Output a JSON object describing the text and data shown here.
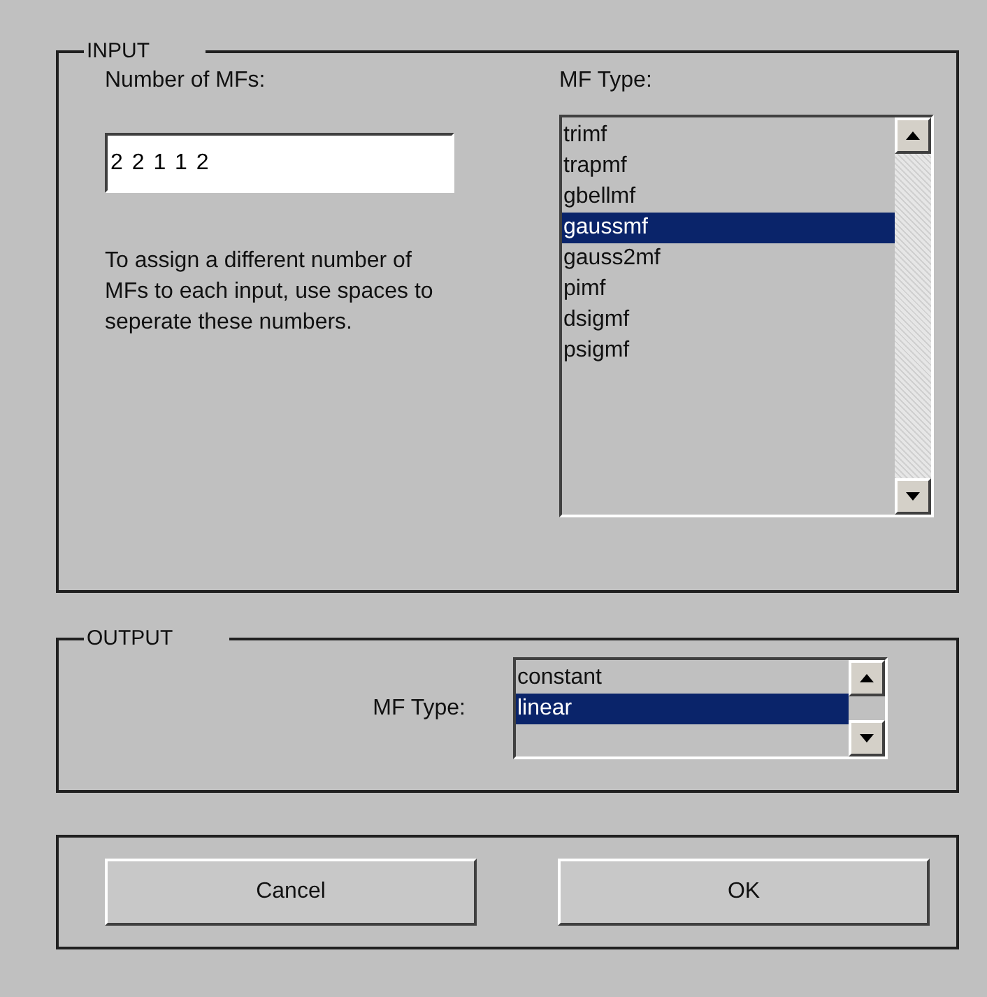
{
  "input": {
    "title": "INPUT",
    "number_label": "Number of MFs:",
    "number_value": "2 2 1 1 2",
    "hint": "To assign a different number of MFs to each input, use spaces to seperate these numbers.",
    "type_label": "MF Type:",
    "types": [
      {
        "label": "trimf",
        "selected": false
      },
      {
        "label": "trapmf",
        "selected": false
      },
      {
        "label": "gbellmf",
        "selected": false
      },
      {
        "label": "gaussmf",
        "selected": true
      },
      {
        "label": "gauss2mf",
        "selected": false
      },
      {
        "label": "pimf",
        "selected": false
      },
      {
        "label": "dsigmf",
        "selected": false
      },
      {
        "label": "psigmf",
        "selected": false
      }
    ]
  },
  "output": {
    "title": "OUTPUT",
    "type_label": "MF Type:",
    "types": [
      {
        "label": "constant",
        "selected": false
      },
      {
        "label": "linear",
        "selected": true
      }
    ]
  },
  "buttons": [
    {
      "label": "Cancel"
    },
    {
      "label": "OK"
    }
  ]
}
